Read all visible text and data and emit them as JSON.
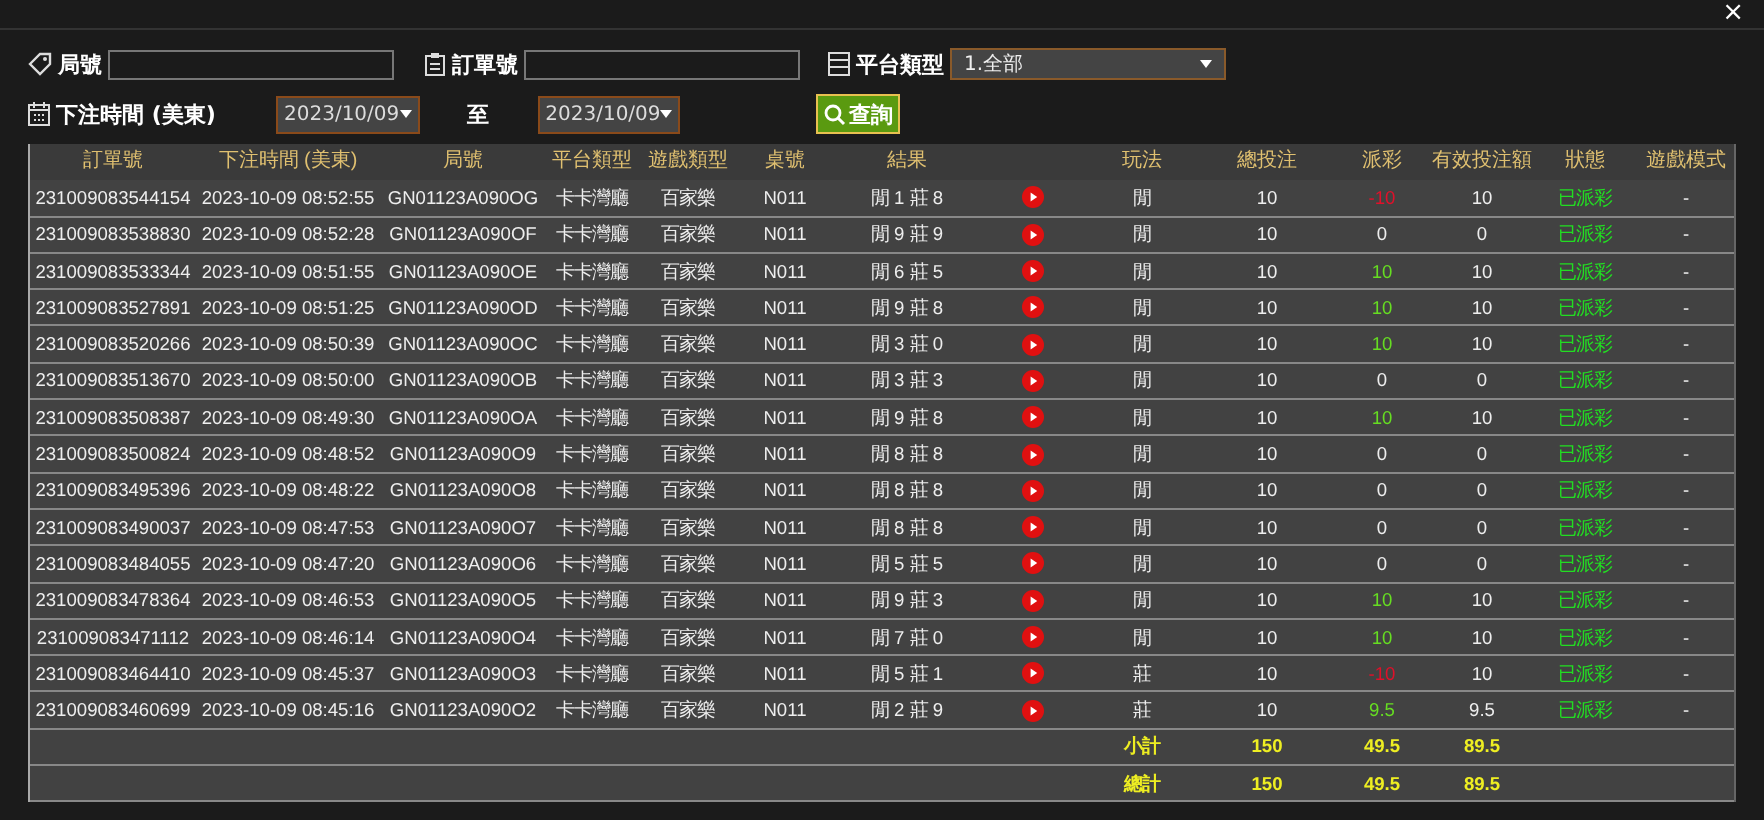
{
  "close_label": "×",
  "filters": {
    "round_label": "局號",
    "order_label": "訂單號",
    "platform_label": "平台類型",
    "platform_value": "1.全部",
    "time_label": "下注時間 (美東)",
    "date_from": "2023/10/09",
    "to_label": "至",
    "date_to": "2023/10/09",
    "search_button": "查詢"
  },
  "table": {
    "columns": [
      "訂單號",
      "下注時間 (美東)",
      "局號",
      "平台類型",
      "遊戲類型",
      "桌號",
      "結果",
      "玩法",
      "總投注",
      "派彩",
      "有效投注額",
      "狀態",
      "遊戲模式"
    ],
    "rows": [
      {
        "order": "231009083544154",
        "time": "2023-10-09 08:52:55",
        "round": "GN01123A090OG",
        "platform": "卡卡灣廳",
        "game": "百家樂",
        "table": "N011",
        "result": "閒 1 莊 8",
        "bet": "閒",
        "total": "10",
        "payout": "-10",
        "color": "#e0102a",
        "valid": "10",
        "status": "已派彩",
        "mode": "-"
      },
      {
        "order": "231009083538830",
        "time": "2023-10-09 08:52:28",
        "round": "GN01123A090OF",
        "platform": "卡卡灣廳",
        "game": "百家樂",
        "table": "N011",
        "result": "閒 9 莊 9",
        "bet": "閒",
        "total": "10",
        "payout": "0",
        "color": "#eeeeee",
        "valid": "0",
        "status": "已派彩",
        "mode": "-"
      },
      {
        "order": "231009083533344",
        "time": "2023-10-09 08:51:55",
        "round": "GN01123A090OE",
        "platform": "卡卡灣廳",
        "game": "百家樂",
        "table": "N011",
        "result": "閒 6 莊 5",
        "bet": "閒",
        "total": "10",
        "payout": "10",
        "color": "#66dd22",
        "valid": "10",
        "status": "已派彩",
        "mode": "-"
      },
      {
        "order": "231009083527891",
        "time": "2023-10-09 08:51:25",
        "round": "GN01123A090OD",
        "platform": "卡卡灣廳",
        "game": "百家樂",
        "table": "N011",
        "result": "閒 9 莊 8",
        "bet": "閒",
        "total": "10",
        "payout": "10",
        "color": "#66dd22",
        "valid": "10",
        "status": "已派彩",
        "mode": "-"
      },
      {
        "order": "231009083520266",
        "time": "2023-10-09 08:50:39",
        "round": "GN01123A090OC",
        "platform": "卡卡灣廳",
        "game": "百家樂",
        "table": "N011",
        "result": "閒 3 莊 0",
        "bet": "閒",
        "total": "10",
        "payout": "10",
        "color": "#66dd22",
        "valid": "10",
        "status": "已派彩",
        "mode": "-"
      },
      {
        "order": "231009083513670",
        "time": "2023-10-09 08:50:00",
        "round": "GN01123A090OB",
        "platform": "卡卡灣廳",
        "game": "百家樂",
        "table": "N011",
        "result": "閒 3 莊 3",
        "bet": "閒",
        "total": "10",
        "payout": "0",
        "color": "#eeeeee",
        "valid": "0",
        "status": "已派彩",
        "mode": "-"
      },
      {
        "order": "231009083508387",
        "time": "2023-10-09 08:49:30",
        "round": "GN01123A090OA",
        "platform": "卡卡灣廳",
        "game": "百家樂",
        "table": "N011",
        "result": "閒 9 莊 8",
        "bet": "閒",
        "total": "10",
        "payout": "10",
        "color": "#66dd22",
        "valid": "10",
        "status": "已派彩",
        "mode": "-"
      },
      {
        "order": "231009083500824",
        "time": "2023-10-09 08:48:52",
        "round": "GN01123A090O9",
        "platform": "卡卡灣廳",
        "game": "百家樂",
        "table": "N011",
        "result": "閒 8 莊 8",
        "bet": "閒",
        "total": "10",
        "payout": "0",
        "color": "#eeeeee",
        "valid": "0",
        "status": "已派彩",
        "mode": "-"
      },
      {
        "order": "231009083495396",
        "time": "2023-10-09 08:48:22",
        "round": "GN01123A090O8",
        "platform": "卡卡灣廳",
        "game": "百家樂",
        "table": "N011",
        "result": "閒 8 莊 8",
        "bet": "閒",
        "total": "10",
        "payout": "0",
        "color": "#eeeeee",
        "valid": "0",
        "status": "已派彩",
        "mode": "-"
      },
      {
        "order": "231009083490037",
        "time": "2023-10-09 08:47:53",
        "round": "GN01123A090O7",
        "platform": "卡卡灣廳",
        "game": "百家樂",
        "table": "N011",
        "result": "閒 8 莊 8",
        "bet": "閒",
        "total": "10",
        "payout": "0",
        "color": "#eeeeee",
        "valid": "0",
        "status": "已派彩",
        "mode": "-"
      },
      {
        "order": "231009083484055",
        "time": "2023-10-09 08:47:20",
        "round": "GN01123A090O6",
        "platform": "卡卡灣廳",
        "game": "百家樂",
        "table": "N011",
        "result": "閒 5 莊 5",
        "bet": "閒",
        "total": "10",
        "payout": "0",
        "color": "#eeeeee",
        "valid": "0",
        "status": "已派彩",
        "mode": "-"
      },
      {
        "order": "231009083478364",
        "time": "2023-10-09 08:46:53",
        "round": "GN01123A090O5",
        "platform": "卡卡灣廳",
        "game": "百家樂",
        "table": "N011",
        "result": "閒 9 莊 3",
        "bet": "閒",
        "total": "10",
        "payout": "10",
        "color": "#66dd22",
        "valid": "10",
        "status": "已派彩",
        "mode": "-"
      },
      {
        "order": "231009083471112",
        "time": "2023-10-09 08:46:14",
        "round": "GN01123A090O4",
        "platform": "卡卡灣廳",
        "game": "百家樂",
        "table": "N011",
        "result": "閒 7 莊 0",
        "bet": "閒",
        "total": "10",
        "payout": "10",
        "color": "#66dd22",
        "valid": "10",
        "status": "已派彩",
        "mode": "-"
      },
      {
        "order": "231009083464410",
        "time": "2023-10-09 08:45:37",
        "round": "GN01123A090O3",
        "platform": "卡卡灣廳",
        "game": "百家樂",
        "table": "N011",
        "result": "閒 5 莊 1",
        "bet": "莊",
        "total": "10",
        "payout": "-10",
        "color": "#e0102a",
        "valid": "10",
        "status": "已派彩",
        "mode": "-"
      },
      {
        "order": "231009083460699",
        "time": "2023-10-09 08:45:16",
        "round": "GN01123A090O2",
        "platform": "卡卡灣廳",
        "game": "百家樂",
        "table": "N011",
        "result": "閒 2 莊 9",
        "bet": "莊",
        "total": "10",
        "payout": "9.5",
        "color": "#66dd22",
        "valid": "9.5",
        "status": "已派彩",
        "mode": "-"
      }
    ],
    "summaries": [
      {
        "label": "小計",
        "total": "150",
        "payout": "49.5",
        "valid": "89.5"
      },
      {
        "label": "總計",
        "total": "150",
        "payout": "49.5",
        "valid": "89.5"
      }
    ]
  }
}
